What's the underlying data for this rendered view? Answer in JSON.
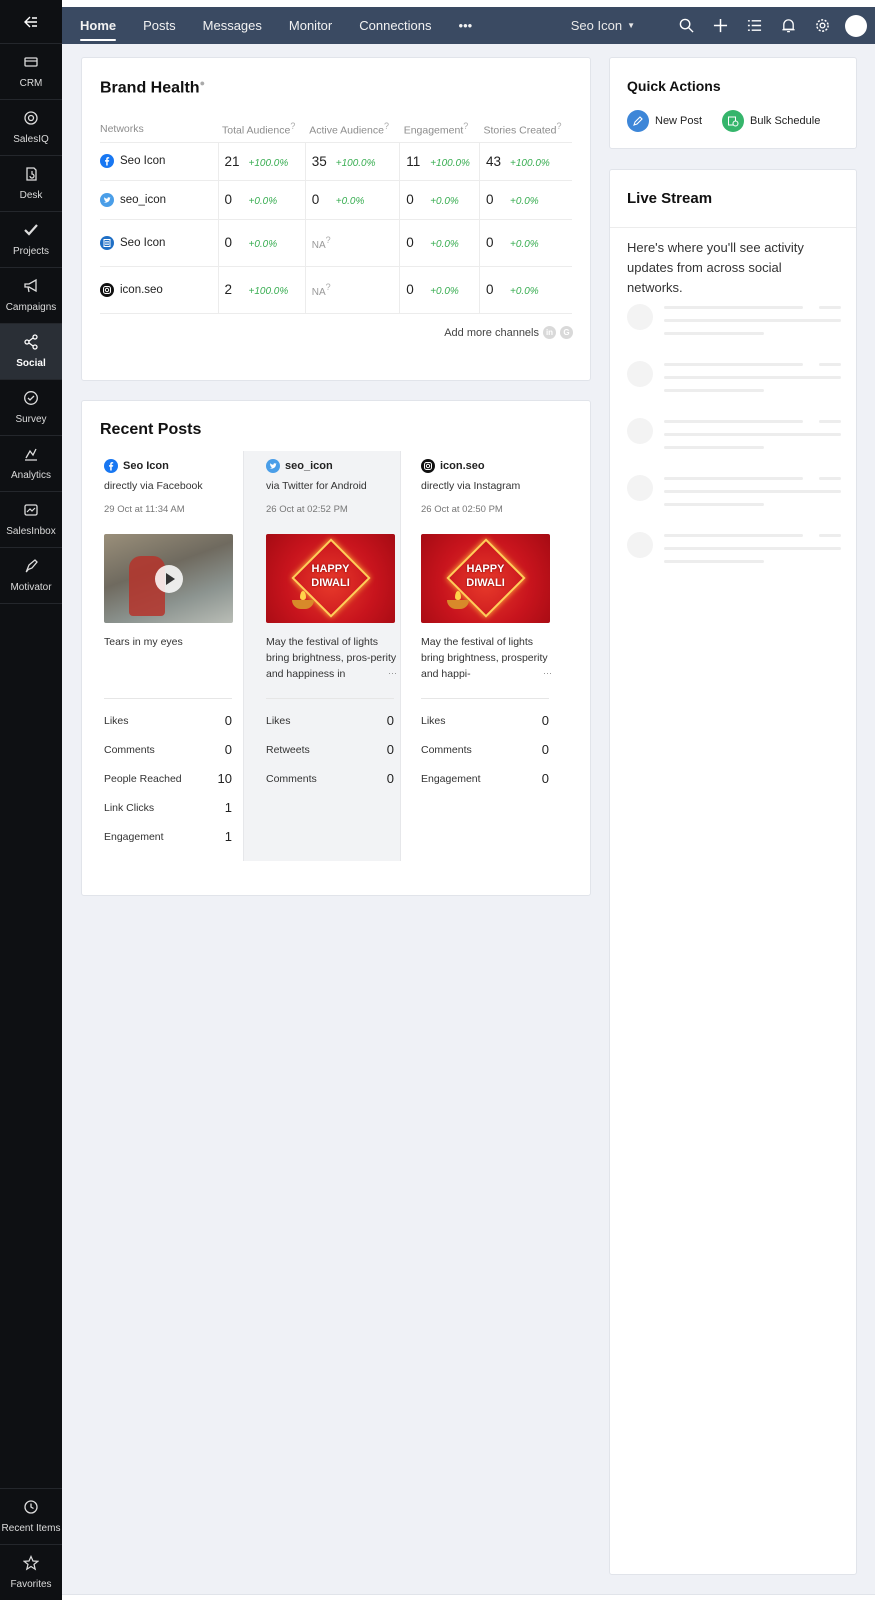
{
  "sidebar": {
    "items": [
      {
        "label": "CRM",
        "icon": "crm-icon"
      },
      {
        "label": "SalesIQ",
        "icon": "salesiq-icon"
      },
      {
        "label": "Desk",
        "icon": "desk-icon"
      },
      {
        "label": "Projects",
        "icon": "projects-icon"
      },
      {
        "label": "Campaigns",
        "icon": "campaigns-icon"
      },
      {
        "label": "Social",
        "icon": "social-icon",
        "active": true
      },
      {
        "label": "Survey",
        "icon": "survey-icon"
      },
      {
        "label": "Analytics",
        "icon": "analytics-icon"
      },
      {
        "label": "SalesInbox",
        "icon": "salesinbox-icon"
      },
      {
        "label": "Motivator",
        "icon": "motivator-icon"
      }
    ],
    "bottom": [
      {
        "label": "Recent Items",
        "icon": "history-icon"
      },
      {
        "label": "Favorites",
        "icon": "star-icon"
      }
    ]
  },
  "topnav": {
    "tabs": [
      "Home",
      "Posts",
      "Messages",
      "Monitor",
      "Connections"
    ],
    "more": "•••",
    "brand": "Seo Icon"
  },
  "brand_health": {
    "title": "Brand Health",
    "columns": [
      "Networks",
      "Total Audience",
      "Active Audience",
      "Engagement",
      "Stories Created"
    ],
    "rows": [
      {
        "network": "Seo Icon",
        "icon": "facebook-icon",
        "total": "21",
        "total_pct": "+100.0%",
        "active": "35",
        "active_pct": "+100.0%",
        "engagement": "11",
        "engagement_pct": "+100.0%",
        "stories": "43",
        "stories_pct": "+100.0%"
      },
      {
        "network": "seo_icon",
        "icon": "twitter-icon",
        "total": "0",
        "total_pct": "+0.0%",
        "active": "0",
        "active_pct": "+0.0%",
        "engagement": "0",
        "engagement_pct": "+0.0%",
        "stories": "0",
        "stories_pct": "+0.0%"
      },
      {
        "network": "Seo Icon",
        "icon": "page-icon",
        "total": "0",
        "total_pct": "+0.0%",
        "active": "NA",
        "active_pct": "",
        "engagement": "0",
        "engagement_pct": "+0.0%",
        "stories": "0",
        "stories_pct": "+0.0%"
      },
      {
        "network": "icon.seo",
        "icon": "instagram-icon",
        "total": "2",
        "total_pct": "+100.0%",
        "active": "NA",
        "active_pct": "",
        "engagement": "0",
        "engagement_pct": "+0.0%",
        "stories": "0",
        "stories_pct": "+0.0%"
      }
    ],
    "add_more": "Add more channels",
    "channel_icons": [
      "in",
      "G"
    ]
  },
  "recent_posts": {
    "title": "Recent Posts",
    "posts": [
      {
        "account": "Seo Icon",
        "icon": "facebook-icon",
        "via": "directly via Facebook",
        "date": "29 Oct at 11:34 AM",
        "media": "video",
        "text": "Tears in my eyes",
        "more": "",
        "stats": [
          {
            "label": "Likes",
            "value": "0"
          },
          {
            "label": "Comments",
            "value": "0"
          },
          {
            "label": "People Reached",
            "value": "10"
          },
          {
            "label": "Link Clicks",
            "value": "1"
          },
          {
            "label": "Engagement",
            "value": "1"
          }
        ]
      },
      {
        "account": "seo_icon",
        "icon": "twitter-icon",
        "via": "via Twitter for Android",
        "date": "26 Oct at 02:52 PM",
        "media": "diwali",
        "image_text": [
          "HAPPY",
          "DIWALI"
        ],
        "text": "May the festival of lights bring brightness, pros-perity and happiness in",
        "more": "···",
        "stats": [
          {
            "label": "Likes",
            "value": "0"
          },
          {
            "label": "Retweets",
            "value": "0"
          },
          {
            "label": "Comments",
            "value": "0"
          }
        ]
      },
      {
        "account": "icon.seo",
        "icon": "instagram-icon",
        "via": "directly via Instagram",
        "date": "26 Oct at 02:50 PM",
        "media": "diwali",
        "image_text": [
          "HAPPY",
          "DIWALI"
        ],
        "text": "May the festival of lights bring brightness, prosperity and happi-",
        "more": "···",
        "stats": [
          {
            "label": "Likes",
            "value": "0"
          },
          {
            "label": "Comments",
            "value": "0"
          },
          {
            "label": "Engagement",
            "value": "0"
          }
        ]
      }
    ]
  },
  "quick_actions": {
    "title": "Quick Actions",
    "new_post": "New Post",
    "bulk_schedule": "Bulk Schedule",
    "colors": {
      "new_post": "#3d86d8",
      "bulk_schedule": "#35b56b"
    }
  },
  "live_stream": {
    "title": "Live Stream",
    "message": "Here's where you'll see activity updates from across social networks."
  },
  "colors": {
    "sidebar": "#0e1013",
    "topnav": "#3a4a62",
    "positive": "#3aae53",
    "background": "#eff1f6"
  }
}
